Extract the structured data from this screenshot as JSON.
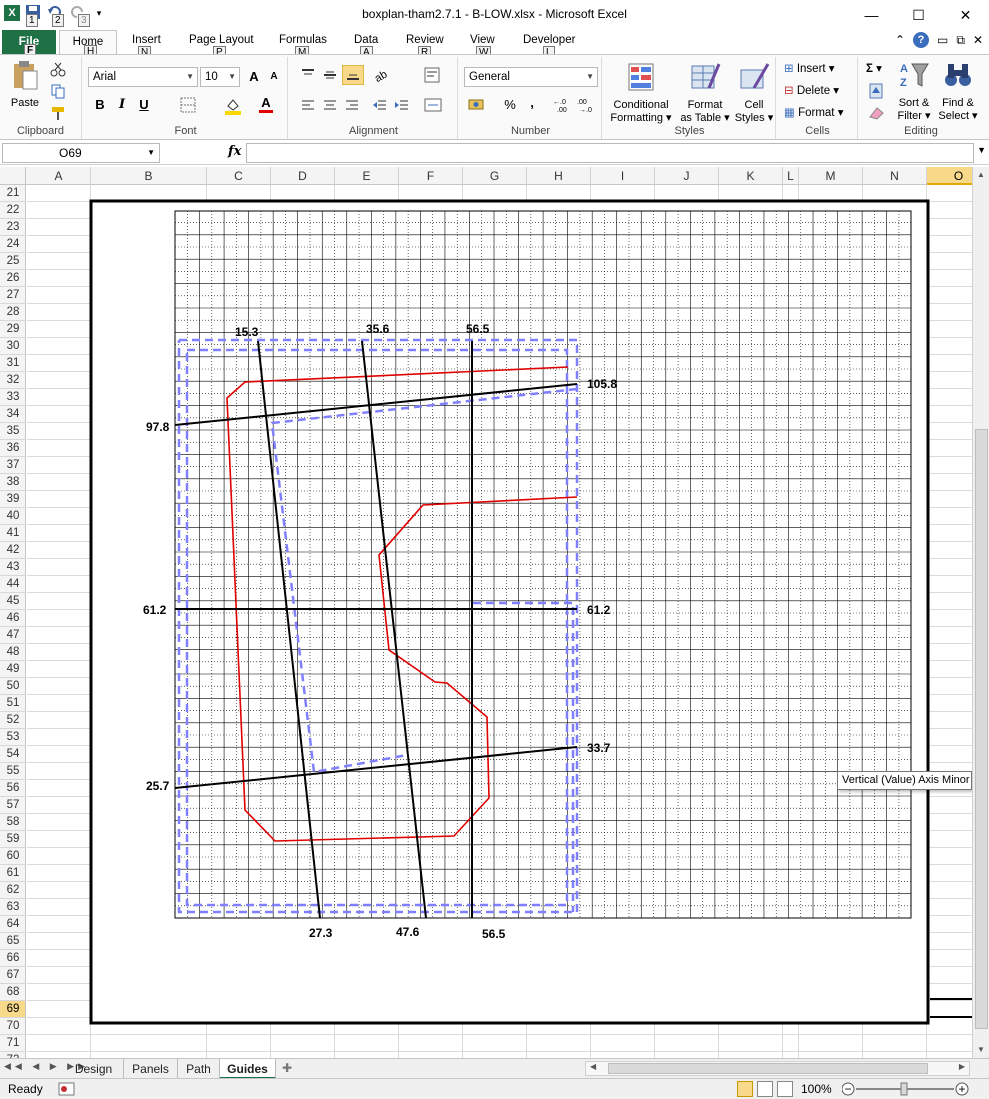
{
  "window": {
    "title": "boxplan-tham2.7.1 - B-LOW.xlsx - Microsoft Excel",
    "app_icon": "X",
    "minimize": "—",
    "maximize": "☐",
    "close": "✕",
    "qat_keytips": [
      "1",
      "2",
      "3"
    ]
  },
  "ribbon_tabs": {
    "file": "File",
    "home": "Home",
    "items": [
      {
        "label": "Insert",
        "keytip": "N"
      },
      {
        "label": "Page Layout",
        "keytip": "P"
      },
      {
        "label": "Formulas",
        "keytip": "M"
      },
      {
        "label": "Data",
        "keytip": "A"
      },
      {
        "label": "Review",
        "keytip": "R"
      },
      {
        "label": "View",
        "keytip": "W"
      },
      {
        "label": "Developer",
        "keytip": "L"
      }
    ],
    "file_keytip": "F",
    "home_keytip": "H"
  },
  "ribbon": {
    "clipboard": {
      "paste": "Paste",
      "label": "Clipboard"
    },
    "font": {
      "name": "Arial",
      "size": "10",
      "bold": "B",
      "italic": "I",
      "underline": "U",
      "grow": "A",
      "shrink": "A",
      "font_color": "A",
      "label": "Font"
    },
    "alignment": {
      "label": "Alignment"
    },
    "number": {
      "format": "General",
      "percent": "%",
      "comma": ",",
      "label": "Number"
    },
    "styles": {
      "conditional": "Conditional",
      "conditional2": "Formatting ▾",
      "format_table": "Format",
      "format_table2": "as Table ▾",
      "cell_styles": "Cell",
      "cell_styles2": "Styles ▾",
      "label": "Styles"
    },
    "cells": {
      "insert": "Insert ▾",
      "delete": "Delete ▾",
      "format": "Format ▾",
      "label": "Cells"
    },
    "editing": {
      "sigma": "Σ ▾",
      "sort": "Sort &",
      "sort2": "Filter ▾",
      "find": "Find &",
      "find2": "Select ▾",
      "label": "Editing"
    }
  },
  "formula_bar": {
    "name_box": "O69",
    "fx": "fx",
    "value": ""
  },
  "columns": [
    "A",
    "B",
    "C",
    "D",
    "E",
    "F",
    "G",
    "H",
    "I",
    "J",
    "K",
    "L",
    "M",
    "N",
    "O"
  ],
  "selected_column": "O",
  "rows": [
    "21",
    "22",
    "23",
    "24",
    "25",
    "26",
    "27",
    "28",
    "29",
    "30",
    "31",
    "32",
    "33",
    "34",
    "35",
    "36",
    "37",
    "38",
    "39",
    "40",
    "41",
    "42",
    "43",
    "44",
    "45",
    "46",
    "47",
    "48",
    "49",
    "50",
    "51",
    "52",
    "53",
    "54",
    "55",
    "56",
    "57",
    "58",
    "59",
    "60",
    "61",
    "62",
    "63",
    "64",
    "65",
    "66",
    "67",
    "68",
    "69",
    "70",
    "71",
    "72"
  ],
  "selected_row": "69",
  "chart": {
    "labels": {
      "top_153": "15.3",
      "top_356": "35.6",
      "top_565": "56.5",
      "right_1058": "105.8",
      "left_978": "97.8",
      "left_612": "61.2",
      "right_612": "61.2",
      "right_337": "33.7",
      "left_257": "25.7",
      "bottom_273": "27.3",
      "bottom_476": "47.6",
      "bottom_565": "56.5"
    },
    "colors": {
      "path": "#e00000",
      "guides": "#000000",
      "panels": "#8080ff"
    }
  },
  "tooltip": "Vertical (Value) Axis Minor Gridlines",
  "sheets": [
    "Design",
    "Panels",
    "Path",
    "Guides"
  ],
  "active_sheet": "Guides",
  "status": {
    "ready": "Ready",
    "zoom": "100%",
    "minus": "−",
    "plus": "+"
  }
}
